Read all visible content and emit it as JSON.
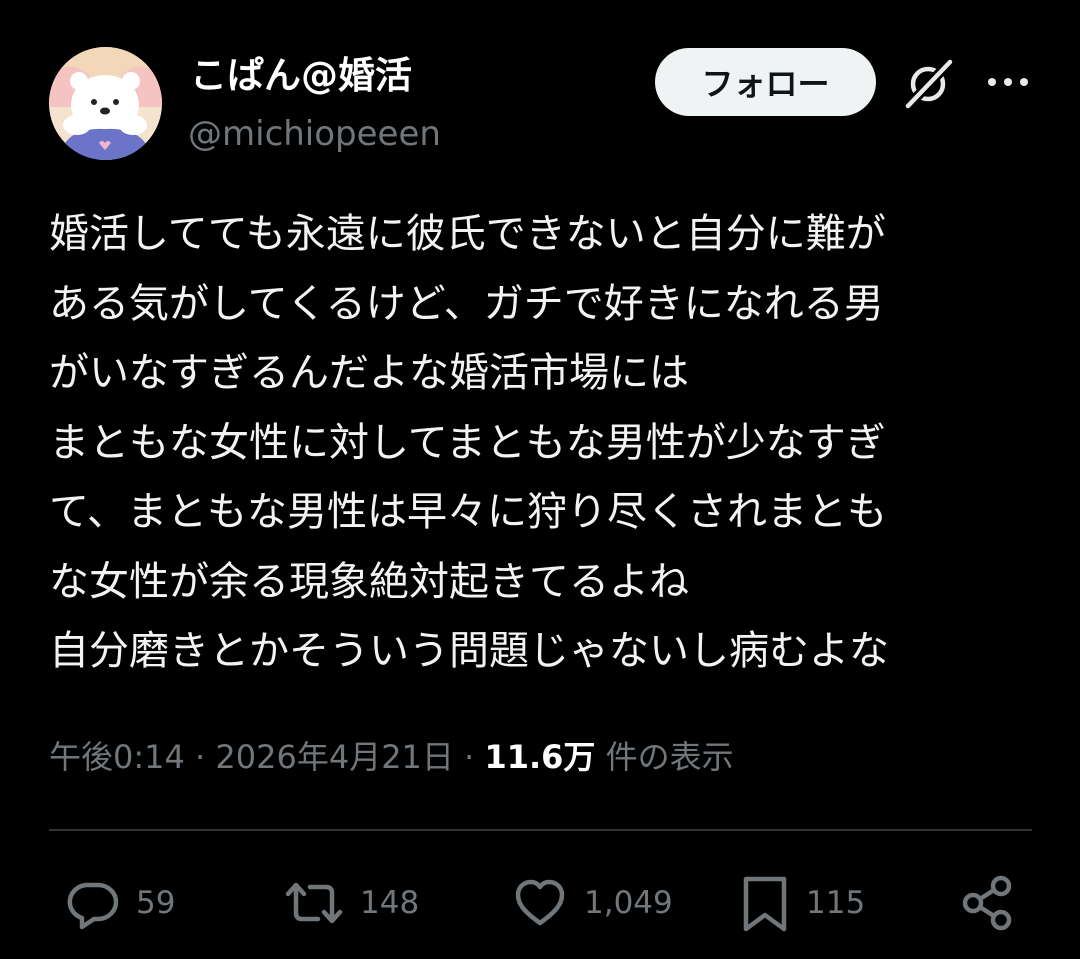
{
  "user": {
    "display_name": "こぱん@婚活",
    "handle": "@michiopeeen"
  },
  "header": {
    "follow_label": "フォロー"
  },
  "tweet": {
    "lines": [
      "婚活してても永遠に彼氏できないと自分に難が",
      "ある気がしてくるけど、ガチで好きになれる男",
      "がいなすぎるんだよな婚活市場には",
      "まともな女性に対してまともな男性が少なすぎ",
      "て、まともな男性は早々に狩り尽くされまとも",
      "な女性が余る現象絶対起きてるよね",
      "自分磨きとかそういう問題じゃないし病むよな"
    ]
  },
  "meta": {
    "time": "午後0:14",
    "separator": "·",
    "date": "2026年4月21日",
    "views_count": "11.6万",
    "views_label": "件の表示"
  },
  "actions": {
    "replies": "59",
    "reposts": "148",
    "likes": "1,049",
    "bookmarks": "115"
  },
  "icons": {
    "reply": "reply-icon",
    "repost": "repost-icon",
    "like": "heart-icon",
    "bookmark": "bookmark-icon",
    "share": "share-icon",
    "grok": "grok-icon",
    "more": "more-icon"
  },
  "colors": {
    "background": "#000000",
    "text": "#e7e9ea",
    "secondary": "#71767b",
    "divider": "#2f3336",
    "follow_bg": "#eff3f4"
  }
}
